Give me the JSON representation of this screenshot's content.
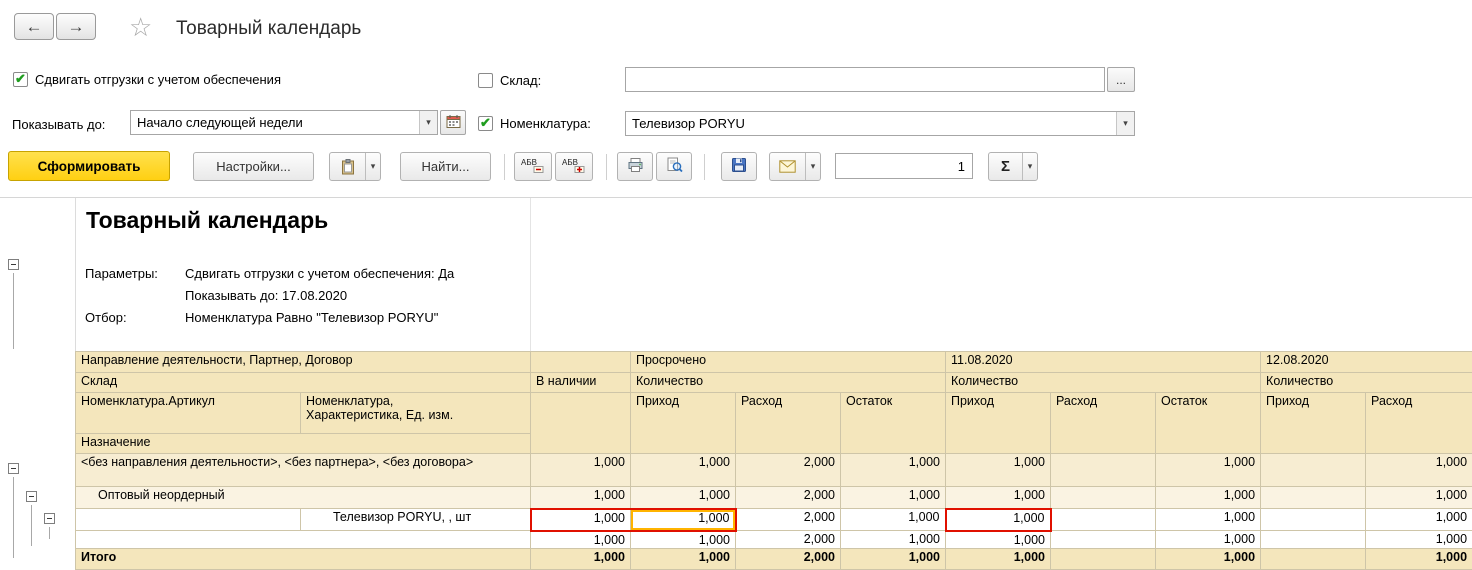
{
  "icons": {
    "back": "←",
    "forward": "→",
    "star": "☆",
    "check": "✔",
    "caret": "▾",
    "ellipsis": "...",
    "sigma": "Σ"
  },
  "window": {
    "title": "Товарный календарь"
  },
  "filters": {
    "shift_label": "Сдвигать отгрузки с учетом обеспечения",
    "warehouse_label": "Склад:",
    "warehouse_value": "",
    "show_until_label": "Показывать до:",
    "show_until_value": "Начало следующей недели",
    "nomenclature_label": "Номенклатура:",
    "nomenclature_value": "Телевизор PORYU"
  },
  "toolbar": {
    "generate_label": "Сформировать",
    "settings_label": "Настройки...",
    "find_label": "Найти...",
    "counter_value": "1"
  },
  "report_header": {
    "title": "Товарный календарь",
    "parameters_label": "Параметры:",
    "parameter_lines": [
      "Сдвигать отгрузки с учетом обеспечения: Да",
      "Показывать до: 17.08.2020"
    ],
    "filter_label": "Отбор:",
    "filter_value": "Номенклатура Равно \"Телевизор PORYU\""
  },
  "table": {
    "header": {
      "row1_label": "Направление деятельности, Партнер, Договор",
      "groups": [
        "Просрочено",
        "11.08.2020",
        "12.08.2020"
      ],
      "row2_label": "Склад",
      "in_stock_label": "В наличии",
      "quantity_label": "Количество",
      "row3_col1": "Номенклатура.Артикул",
      "row3_col2": "Номенклатура,\nХарактеристика, Ед. изм.",
      "measure_cols": [
        "Приход",
        "Расход",
        "Остаток",
        "Приход",
        "Расход",
        "Остаток",
        "Приход",
        "Расход"
      ],
      "row4_label": "Назначение"
    },
    "rows": [
      {
        "style": "group1",
        "label": "<без направления деятельности>, <без партнера>, <без договора>",
        "values": [
          "1,000",
          "1,000",
          "2,000",
          "1,000",
          "1,000",
          "",
          "1,000",
          "",
          "1,000"
        ]
      },
      {
        "style": "group2",
        "label": "Оптовый неордерный",
        "values": [
          "1,000",
          "1,000",
          "2,000",
          "1,000",
          "1,000",
          "",
          "1,000",
          "",
          "1,000"
        ]
      },
      {
        "style": "detail",
        "label_col": 2,
        "label": "Телевизор PORYU, , шт",
        "values": [
          "1,000",
          "1,000",
          "2,000",
          "1,000",
          "1,000",
          "",
          "1,000",
          "",
          "1,000"
        ],
        "red_boxes": [
          [
            0,
            1
          ],
          [
            4
          ]
        ],
        "selected_cell": 1
      },
      {
        "style": "detail2",
        "label": "",
        "values": [
          "1,000",
          "1,000",
          "2,000",
          "1,000",
          "1,000",
          "",
          "1,000",
          "",
          "1,000"
        ]
      },
      {
        "style": "total",
        "label": "Итого",
        "values": [
          "1,000",
          "1,000",
          "2,000",
          "1,000",
          "1,000",
          "",
          "1,000",
          "",
          "1,000"
        ]
      }
    ]
  }
}
